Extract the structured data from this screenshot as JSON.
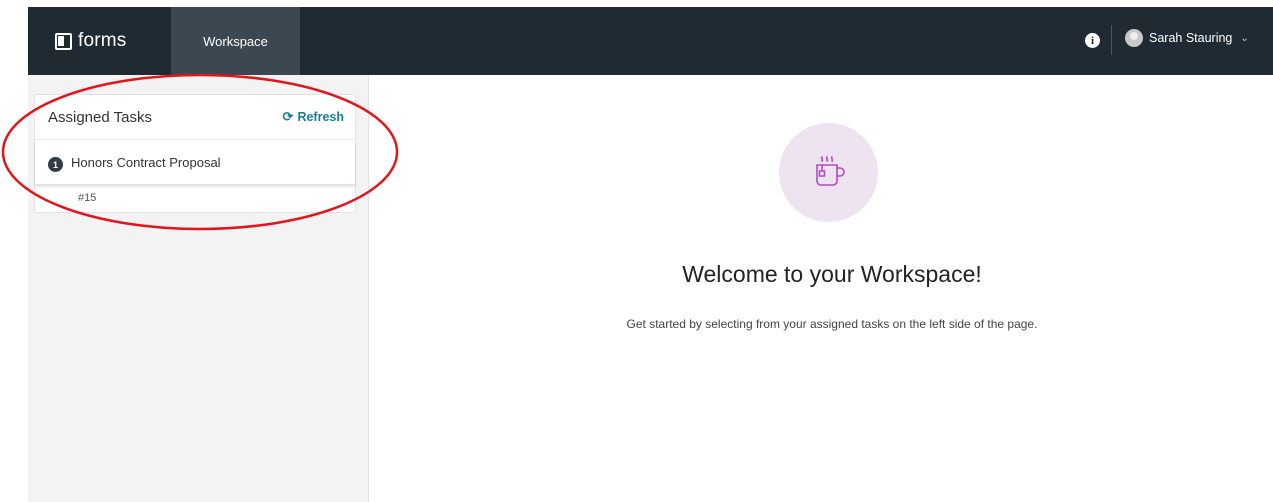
{
  "header": {
    "brand": "forms",
    "nav_tab": "Workspace",
    "info_icon": "info-icon",
    "user": {
      "name": "Sarah Stauring",
      "avatar_icon": "user-avatar-icon",
      "dropdown_icon": "chevron-down-icon"
    }
  },
  "sidebar": {
    "card_title": "Assigned Tasks",
    "refresh_label": "Refresh",
    "tasks": [
      {
        "badge": "1",
        "label": "Honors Contract Proposal",
        "id": "#15"
      }
    ]
  },
  "main": {
    "icon": "coffee-mug-icon",
    "welcome_title": "Welcome to your Workspace!",
    "welcome_text": "Get started by selecting from your assigned tasks on the left side of the page."
  },
  "colors": {
    "topbar": "#1f2a33",
    "active_tab": "#3b4751",
    "refresh_accent": "#1a7f96",
    "annotation_circle": "#e0161c",
    "mug_bg": "#eee3f1",
    "mug_stroke": "#b04bc4"
  }
}
